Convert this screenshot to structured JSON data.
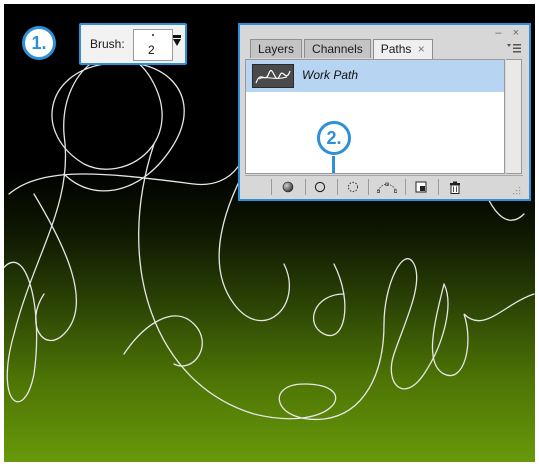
{
  "steps": {
    "step1": "1.",
    "step2": "2."
  },
  "brush": {
    "label": "Brush:",
    "size": "2",
    "icon": "dropdown-arrow-icon"
  },
  "panel": {
    "tabs": [
      {
        "label": "Layers",
        "active": false
      },
      {
        "label": "Channels",
        "active": false
      },
      {
        "label": "Paths",
        "active": true
      }
    ],
    "tab_close": "×",
    "window_controls": "– ×",
    "menu_icon": "panel-menu-icon",
    "paths": [
      {
        "name": "Work Path",
        "selected": true
      }
    ],
    "toolbar": [
      "fill-path-icon",
      "stroke-path-icon",
      "load-selection-icon",
      "make-work-path-icon",
      "new-path-icon",
      "trash-icon"
    ]
  },
  "colors": {
    "accent": "#2f8fd8",
    "selection": "#b7d5f3",
    "canvas_top": "#000000",
    "canvas_bottom": "#68990a"
  }
}
